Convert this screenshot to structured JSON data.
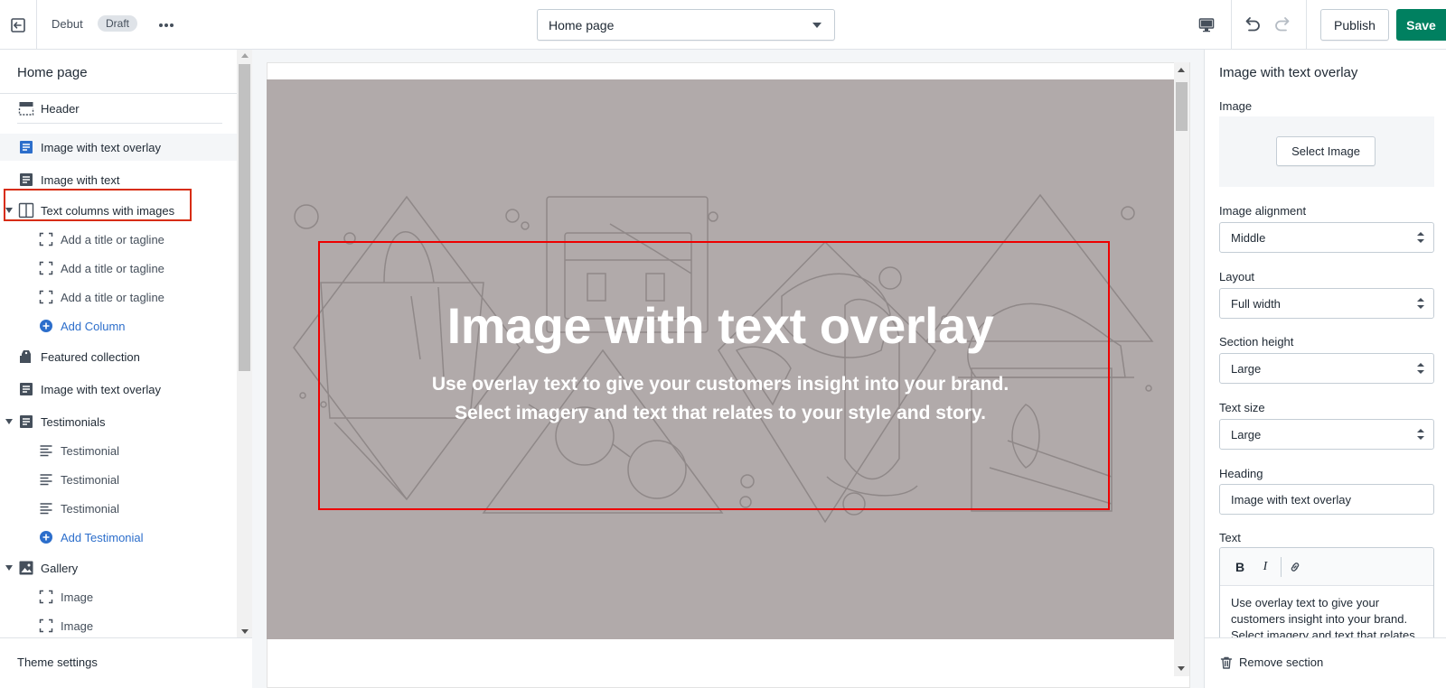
{
  "topbar": {
    "theme_name": "Debut",
    "status_badge": "Draft",
    "page_select": "Home page",
    "publish_label": "Publish",
    "save_label": "Save"
  },
  "sidebar": {
    "title": "Home page",
    "items": [
      {
        "label": "Header",
        "icon": "header-icon",
        "level": 0
      },
      {
        "label": "Image with text overlay",
        "icon": "section-icon",
        "level": 0,
        "active": true
      },
      {
        "label": "Image with text",
        "icon": "section-icon",
        "level": 0
      },
      {
        "label": "Text columns with images",
        "icon": "columns-icon",
        "level": 0,
        "expanded": true
      },
      {
        "label": "Add a title or tagline",
        "icon": "block-icon",
        "level": 1
      },
      {
        "label": "Add a title or tagline",
        "icon": "block-icon",
        "level": 1
      },
      {
        "label": "Add a title or tagline",
        "icon": "block-icon",
        "level": 1
      },
      {
        "label": "Add Column",
        "icon": "add-circle-icon",
        "level": 1
      },
      {
        "label": "Featured collection",
        "icon": "collection-icon",
        "level": 0
      },
      {
        "label": "Image with text overlay",
        "icon": "section-icon",
        "level": 0
      },
      {
        "label": "Testimonials",
        "icon": "section-icon",
        "level": 0,
        "expanded": true
      },
      {
        "label": "Testimonial",
        "icon": "text-lines-icon",
        "level": 1
      },
      {
        "label": "Testimonial",
        "icon": "text-lines-icon",
        "level": 1
      },
      {
        "label": "Testimonial",
        "icon": "text-lines-icon",
        "level": 1
      },
      {
        "label": "Add Testimonial",
        "icon": "add-circle-icon",
        "level": 1
      },
      {
        "label": "Gallery",
        "icon": "gallery-icon",
        "level": 0,
        "expanded": true
      },
      {
        "label": "Image",
        "icon": "block-icon",
        "level": 1
      },
      {
        "label": "Image",
        "icon": "block-icon",
        "level": 1
      }
    ],
    "footer_label": "Theme settings"
  },
  "preview": {
    "hero_title": "Image with text overlay",
    "hero_text": "Use overlay text to give your customers insight into your brand. Select imagery and text that relates to your style and story."
  },
  "panel": {
    "title": "Image with text overlay",
    "image_label": "Image",
    "select_image_label": "Select Image",
    "alignment_label": "Image alignment",
    "alignment_value": "Middle",
    "layout_label": "Layout",
    "layout_value": "Full width",
    "height_label": "Section height",
    "height_value": "Large",
    "text_size_label": "Text size",
    "text_size_value": "Large",
    "heading_label": "Heading",
    "heading_value": "Image with text overlay",
    "text_label": "Text",
    "text_value": "Use overlay text to give your customers insight into your brand. Select imagery and text that relates",
    "bold_label": "B",
    "italic_label": "I",
    "remove_label": "Remove section"
  },
  "colors": {
    "accent_green": "#008060",
    "link_blue": "#2c6ecb",
    "hero_bg": "#b1aaaa",
    "highlight_red": "#d72c0d"
  }
}
